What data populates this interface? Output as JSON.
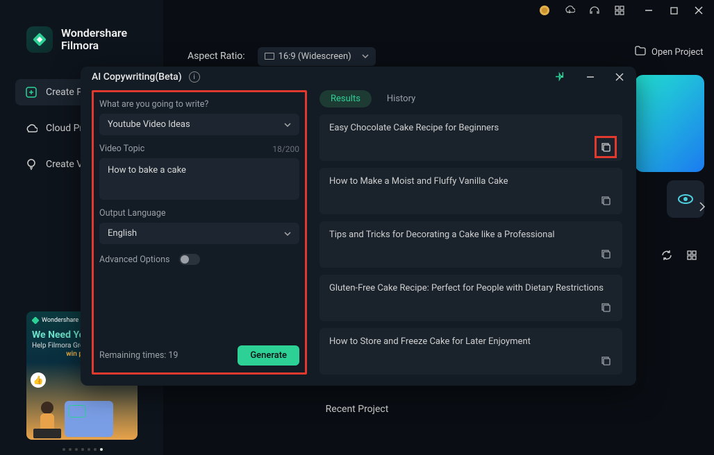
{
  "brand": {
    "line1": "Wondershare",
    "line2": "Filmora"
  },
  "sidebar": {
    "items": [
      {
        "label": "Create Project"
      },
      {
        "label": "Cloud Project"
      },
      {
        "label": "Create Video"
      }
    ]
  },
  "promo": {
    "brand": "Wondershare Filmora",
    "headline": "We Need You",
    "sub": "Help Filmora Grow and",
    "win": "win prizes"
  },
  "topbar": {
    "aspect_ratio_label": "Aspect Ratio:",
    "aspect_ratio_value": "16:9 (Widescreen)",
    "open_project": "Open Project"
  },
  "modal": {
    "title": "AI Copywriting(Beta)",
    "left": {
      "q_label": "What are you going to write?",
      "write_type": "Youtube Video Ideas",
      "topic_label": "Video Topic",
      "topic_value": "How to bake a cake",
      "topic_count": "18/200",
      "lang_label": "Output Language",
      "lang_value": "English",
      "adv_label": "Advanced Options",
      "remaining": "Remaining times: 19",
      "generate": "Generate"
    },
    "tabs": {
      "results": "Results",
      "history": "History"
    },
    "results": [
      "Easy Chocolate Cake Recipe for Beginners",
      "How to Make a Moist and Fluffy Vanilla Cake",
      "Tips and Tricks for Decorating a Cake like a Professional",
      "Gluten-Free Cake Recipe: Perfect for People with Dietary Restrictions",
      "How to Store and Freeze Cake for Later Enjoyment"
    ]
  },
  "recent_project": "Recent Project"
}
